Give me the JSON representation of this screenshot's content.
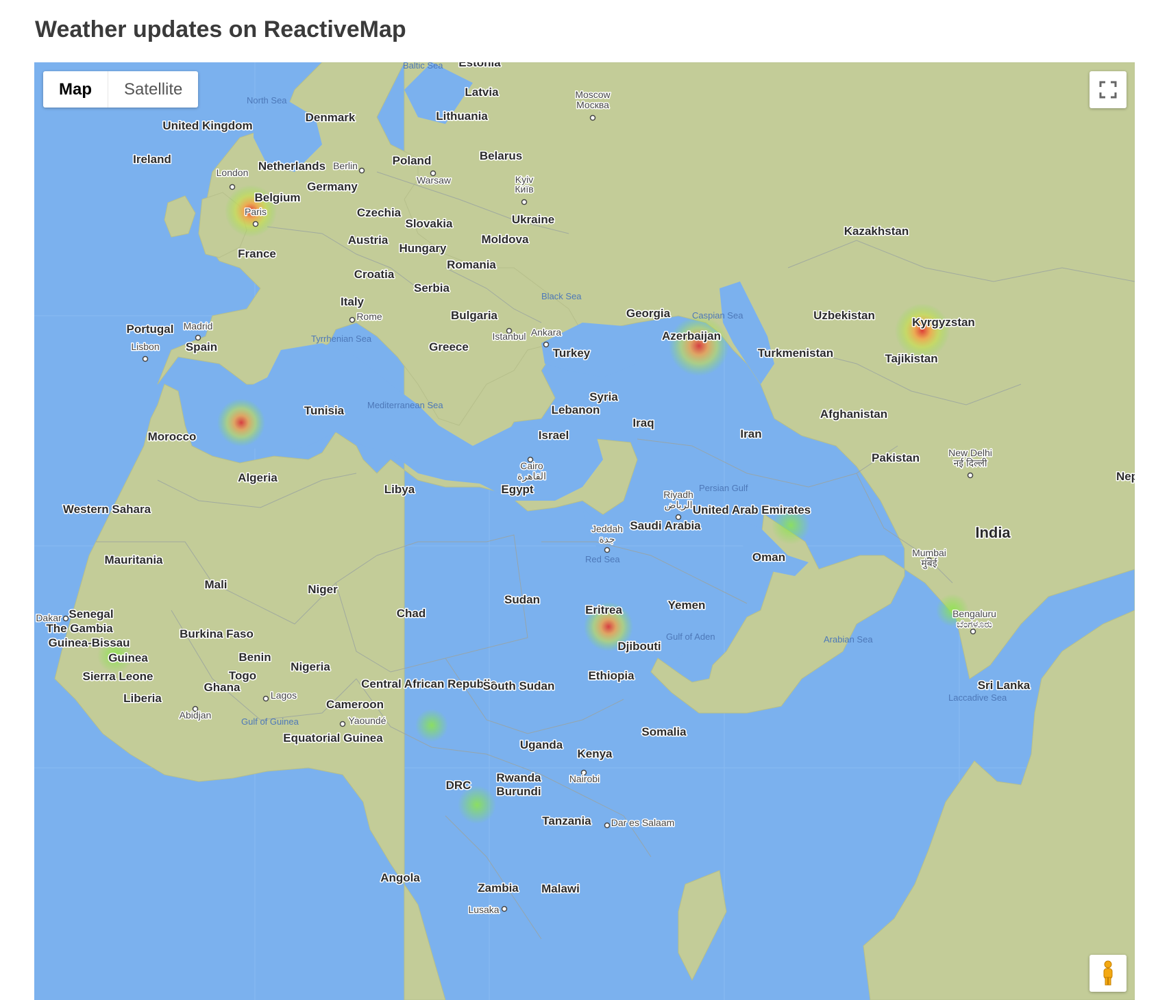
{
  "page": {
    "title": "Weather updates on ReactiveMap"
  },
  "map_controls": {
    "map_label": "Map",
    "satellite_label": "Satellite",
    "active_type": "Map"
  },
  "colors": {
    "water": "#7bb1ee",
    "land": "#c3cc98",
    "border": "#9aa3a0",
    "heat_low": "#7de34a",
    "heat_mid": "#f6c343",
    "heat_high": "#e0312e"
  },
  "countries": [
    {
      "name": "Estonia"
    },
    {
      "name": "Latvia"
    },
    {
      "name": "Lithuania"
    },
    {
      "name": "Denmark"
    },
    {
      "name": "United Kingdom"
    },
    {
      "name": "Ireland"
    },
    {
      "name": "Netherlands"
    },
    {
      "name": "Belgium"
    },
    {
      "name": "Germany"
    },
    {
      "name": "Poland"
    },
    {
      "name": "Belarus"
    },
    {
      "name": "Czechia"
    },
    {
      "name": "Slovakia"
    },
    {
      "name": "Ukraine"
    },
    {
      "name": "Austria"
    },
    {
      "name": "Hungary"
    },
    {
      "name": "Moldova"
    },
    {
      "name": "France"
    },
    {
      "name": "Romania"
    },
    {
      "name": "Croatia"
    },
    {
      "name": "Serbia"
    },
    {
      "name": "Italy"
    },
    {
      "name": "Bulgaria"
    },
    {
      "name": "Portugal"
    },
    {
      "name": "Spain"
    },
    {
      "name": "Greece"
    },
    {
      "name": "Turkey"
    },
    {
      "name": "Georgia"
    },
    {
      "name": "Azerbaijan"
    },
    {
      "name": "Uzbekistan"
    },
    {
      "name": "Kyrgyzstan"
    },
    {
      "name": "Turkmenistan"
    },
    {
      "name": "Tajikistan"
    },
    {
      "name": "Kazakhstan"
    },
    {
      "name": "Tunisia"
    },
    {
      "name": "Syria"
    },
    {
      "name": "Lebanon"
    },
    {
      "name": "Israel"
    },
    {
      "name": "Iraq"
    },
    {
      "name": "Iran"
    },
    {
      "name": "Afghanistan"
    },
    {
      "name": "Pakistan"
    },
    {
      "name": "Morocco"
    },
    {
      "name": "Algeria"
    },
    {
      "name": "Libya"
    },
    {
      "name": "Egypt"
    },
    {
      "name": "Saudi Arabia"
    },
    {
      "name": "United Arab Emirates"
    },
    {
      "name": "Oman"
    },
    {
      "name": "India"
    },
    {
      "name": "Western Sahara"
    },
    {
      "name": "Mauritania"
    },
    {
      "name": "Mali"
    },
    {
      "name": "Niger"
    },
    {
      "name": "Chad"
    },
    {
      "name": "Sudan"
    },
    {
      "name": "Eritrea"
    },
    {
      "name": "Yemen"
    },
    {
      "name": "Djibouti"
    },
    {
      "name": "Ethiopia"
    },
    {
      "name": "Senegal"
    },
    {
      "name": "The Gambia"
    },
    {
      "name": "Guinea-Bissau"
    },
    {
      "name": "Guinea"
    },
    {
      "name": "Sierra Leone"
    },
    {
      "name": "Liberia"
    },
    {
      "name": "Burkina Faso"
    },
    {
      "name": "Benin"
    },
    {
      "name": "Togo"
    },
    {
      "name": "Ghana"
    },
    {
      "name": "Nigeria"
    },
    {
      "name": "Cameroon"
    },
    {
      "name": "Central African Republic"
    },
    {
      "name": "South Sudan"
    },
    {
      "name": "Somalia"
    },
    {
      "name": "Equatorial Guinea"
    },
    {
      "name": "Uganda"
    },
    {
      "name": "Kenya"
    },
    {
      "name": "DRC"
    },
    {
      "name": "Rwanda"
    },
    {
      "name": "Burundi"
    },
    {
      "name": "Tanzania"
    },
    {
      "name": "Angola"
    },
    {
      "name": "Zambia"
    },
    {
      "name": "Malawi"
    },
    {
      "name": "Sri Lanka"
    },
    {
      "name": "Nep"
    }
  ],
  "cities": [
    {
      "name": "Moscow"
    },
    {
      "name": "Москва"
    },
    {
      "name": "London"
    },
    {
      "name": "Berlin"
    },
    {
      "name": "Warsaw"
    },
    {
      "name": "Kyiv"
    },
    {
      "name": "Київ"
    },
    {
      "name": "Paris"
    },
    {
      "name": "Rome"
    },
    {
      "name": "Madrid"
    },
    {
      "name": "Lisbon"
    },
    {
      "name": "Istanbul"
    },
    {
      "name": "Ankara"
    },
    {
      "name": "Cairo"
    },
    {
      "name": "القاهرة"
    },
    {
      "name": "Riyadh"
    },
    {
      "name": "الرياض"
    },
    {
      "name": "Jeddah"
    },
    {
      "name": "جدة"
    },
    {
      "name": "New Delhi"
    },
    {
      "name": "नई दिल्ली"
    },
    {
      "name": "Mumbai"
    },
    {
      "name": "मुंबई"
    },
    {
      "name": "Bengaluru"
    },
    {
      "name": "ಬೆಂಗಳೂರು"
    },
    {
      "name": "Dakar"
    },
    {
      "name": "Abidjan"
    },
    {
      "name": "Lagos"
    },
    {
      "name": "Yaoundé"
    },
    {
      "name": "Nairobi"
    },
    {
      "name": "Dar es Salaam"
    },
    {
      "name": "Lusaka"
    }
  ],
  "seas": [
    {
      "name": "Baltic Sea"
    },
    {
      "name": "North Sea"
    },
    {
      "name": "Black Sea"
    },
    {
      "name": "Caspian Sea"
    },
    {
      "name": "Tyrrhenian Sea"
    },
    {
      "name": "Mediterranean Sea"
    },
    {
      "name": "Persian Gulf"
    },
    {
      "name": "Red Sea"
    },
    {
      "name": "Gulf of Aden"
    },
    {
      "name": "Arabian Sea"
    },
    {
      "name": "Laccadive Sea"
    },
    {
      "name": "Gulf of Guinea"
    }
  ],
  "heatmap": [
    {
      "place": "Paris",
      "lat": 48.9,
      "lng": 2.4,
      "intensity": 0.9
    },
    {
      "place": "Algeria",
      "lat": 35.2,
      "lng": 1.3,
      "intensity": 0.8
    },
    {
      "place": "Azerbaijan",
      "lat": 39.8,
      "lng": 48.2,
      "intensity": 1.0
    },
    {
      "place": "Kyrgyzstan",
      "lat": 40.8,
      "lng": 72.5,
      "intensity": 0.95
    },
    {
      "place": "Eritrea",
      "lat": 14.2,
      "lng": 39.0,
      "intensity": 0.85
    },
    {
      "place": "United Arab Emirates",
      "lat": 24.4,
      "lng": 56.0,
      "intensity": 0.4
    },
    {
      "place": "Bengaluru",
      "lat": 13.2,
      "lng": 76.5,
      "intensity": 0.35
    },
    {
      "place": "Guinea",
      "lat": 11.3,
      "lng": -13.6,
      "intensity": 0.35
    },
    {
      "place": "Central African Republic",
      "lat": 1.3,
      "lng": 18.5,
      "intensity": 0.35
    },
    {
      "place": "DRC",
      "lat": -5.3,
      "lng": 24.3,
      "intensity": 0.4
    }
  ]
}
